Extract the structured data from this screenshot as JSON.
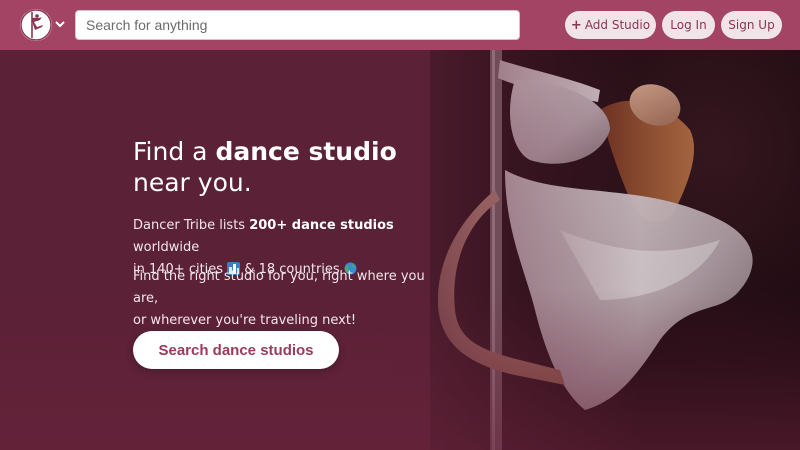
{
  "navbar": {
    "logo_icon": "dancer-logo-icon",
    "menu_icon": "chevron-down-icon",
    "search_placeholder": "Search for anything",
    "add_studio_icon": "plus-icon",
    "add_studio_label": "Add Studio",
    "login_label": "Log In",
    "signup_label": "Sign Up",
    "bg_color": "#a34464"
  },
  "hero": {
    "headline_pre": "Find a ",
    "headline_bold": "dance studio",
    "headline_post": "near you.",
    "para1_pre": "Dancer Tribe lists ",
    "para1_bold": "200+ dance studios",
    "para1_post": " worldwide",
    "para1_line2": "in 140+ cities",
    "cities_emoji": "city-icon",
    "para1_countries": " & 18 countries",
    "globe_emoji": "globe-icon",
    "para2_line1": "Find the right studio for you, right where you are,",
    "para2_line2": "or wherever you're traveling next!",
    "cta_label": "Search dance studios",
    "bg_color": "#5b2036",
    "photo_alt": "pole-dancer-photo"
  }
}
